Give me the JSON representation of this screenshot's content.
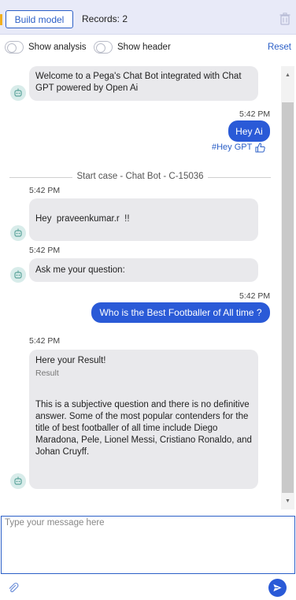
{
  "toolbar": {
    "build_label": "Build model",
    "records_label": "Records:",
    "records_count": "2"
  },
  "toggles": {
    "analysis_label": "Show analysis",
    "header_label": "Show header",
    "reset_label": "Reset"
  },
  "messages": [
    {
      "sender": "bot",
      "text": "Welcome to a Pega's Chat Bot integrated with Chat GPT powered by Open Ai"
    },
    {
      "sender": "user",
      "time": "5:42 PM",
      "text": "Hey Ai",
      "tag": "#Hey GPT"
    },
    {
      "sender": "bot",
      "time": "5:42 PM",
      "text": "Hey  praveenkumar.r  !!"
    },
    {
      "sender": "bot",
      "time": "5:42 PM",
      "text": "Ask me your question:"
    },
    {
      "sender": "user",
      "time": "5:42 PM",
      "text": "Who is the Best Footballer of All time ?"
    },
    {
      "sender": "bot",
      "time": "5:42 PM",
      "title": "Here your Result!",
      "subtitle": "Result",
      "text": "This is a subjective question and there is no definitive answer. Some of the most popular contenders for the title of best footballer of all time include Diego Maradona, Pele, Lionel Messi, Cristiano Ronaldo, and Johan Cruyff."
    }
  ],
  "divider": {
    "label": "Start case - Chat Bot - C-15036"
  },
  "composer": {
    "placeholder": "Type your message here"
  },
  "icons": {
    "trash": "trash-icon",
    "bot": "bot-avatar-icon",
    "thumb": "thumbs-up-icon",
    "attach": "paperclip-icon",
    "send": "send-icon"
  },
  "colors": {
    "accent": "#2a5ad7",
    "link": "#2b5fc7",
    "bubble": "#e9e9ec",
    "header_bg": "#e8eaf8"
  }
}
